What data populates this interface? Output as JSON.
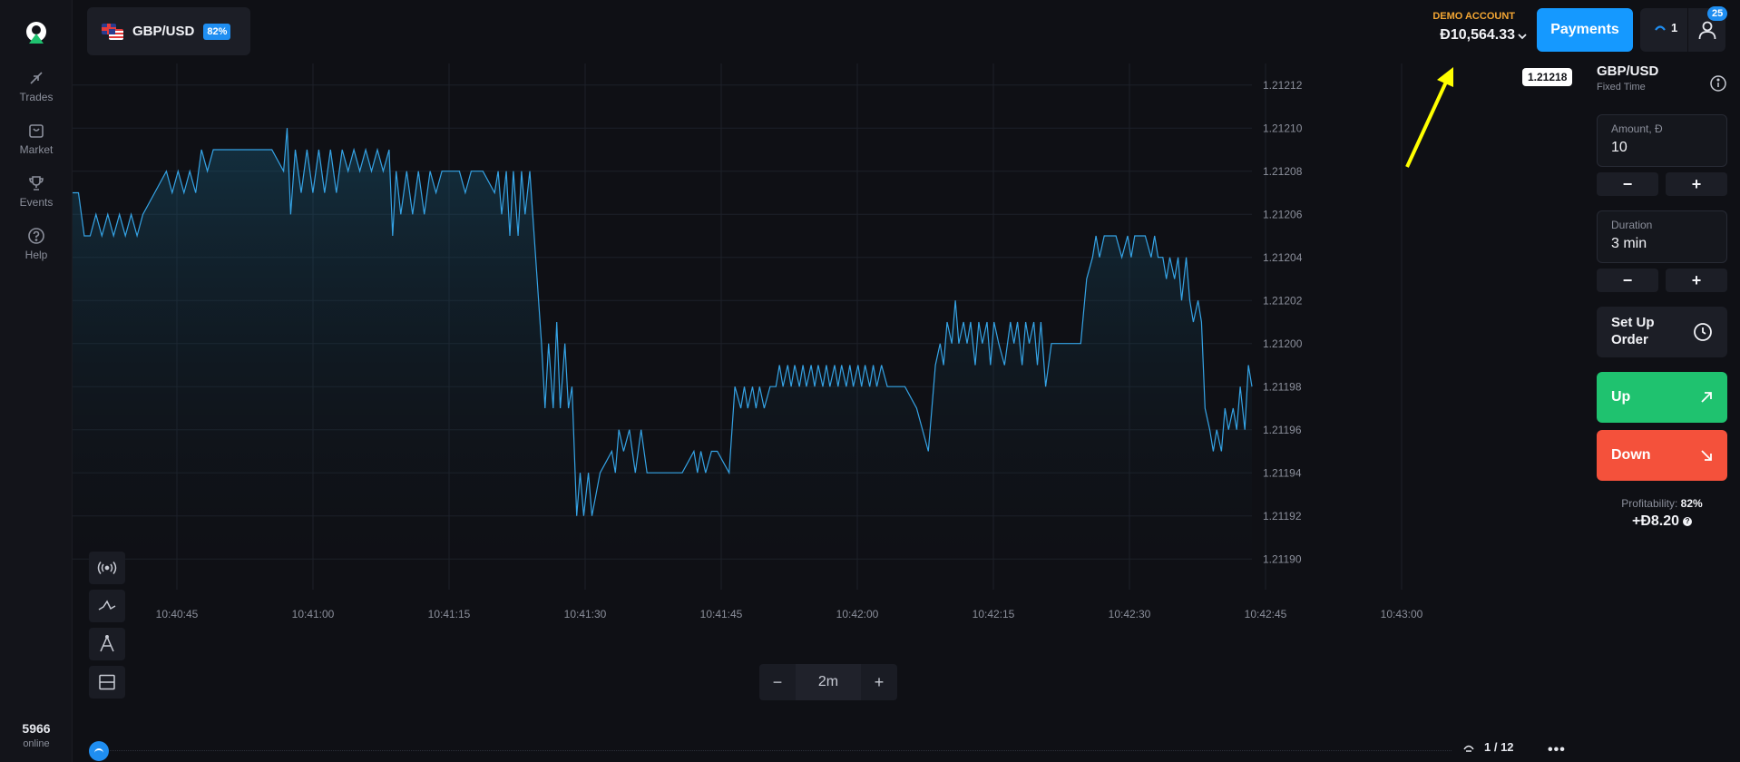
{
  "sidebar": {
    "items": [
      {
        "label": "Trades",
        "icon": "trades-icon"
      },
      {
        "label": "Market",
        "icon": "market-icon"
      },
      {
        "label": "Events",
        "icon": "trophy-icon"
      },
      {
        "label": "Help",
        "icon": "help-icon"
      }
    ],
    "online_count": "5966",
    "online_label": "online"
  },
  "header": {
    "pair": "GBP/USD",
    "payout_badge": "82%",
    "account_label": "DEMO ACCOUNT",
    "balance": "Đ10,564.33",
    "payments_label": "Payments",
    "open_trades": "1",
    "notifications": "25"
  },
  "chart_data": {
    "type": "area",
    "symbol": "GBP/USD",
    "x_tick_labels": [
      "10:40:45",
      "10:41:00",
      "10:41:15",
      "10:41:30",
      "10:41:45",
      "10:42:00",
      "10:42:15",
      "10:42:30",
      "10:42:45",
      "10:43:00"
    ],
    "y_tick_labels": [
      "1.21212",
      "1.21210",
      "1.21208",
      "1.21206",
      "1.21204",
      "1.21202",
      "1.21200",
      "1.21198",
      "1.21196",
      "1.21194",
      "1.21192",
      "1.21190"
    ],
    "ylim": [
      1.21189,
      1.21213
    ],
    "current_price": "1.21218",
    "grid": true,
    "series_color": "#35a3e5",
    "series_points": [
      [
        0,
        1.21207
      ],
      [
        0.5,
        1.21207
      ],
      [
        1,
        1.21205
      ],
      [
        1.5,
        1.21205
      ],
      [
        2,
        1.21206
      ],
      [
        2.5,
        1.21205
      ],
      [
        3,
        1.21206
      ],
      [
        3.5,
        1.21205
      ],
      [
        4,
        1.21206
      ],
      [
        4.5,
        1.21205
      ],
      [
        5,
        1.21206
      ],
      [
        5.5,
        1.21205
      ],
      [
        6,
        1.21206
      ],
      [
        7,
        1.21207
      ],
      [
        8,
        1.21208
      ],
      [
        8.5,
        1.21207
      ],
      [
        9,
        1.21208
      ],
      [
        9.5,
        1.21207
      ],
      [
        10,
        1.21208
      ],
      [
        10.5,
        1.21207
      ],
      [
        11,
        1.21209
      ],
      [
        11.5,
        1.21208
      ],
      [
        12,
        1.21209
      ],
      [
        13,
        1.21209
      ],
      [
        15,
        1.21209
      ],
      [
        17,
        1.21209
      ],
      [
        18,
        1.21208
      ],
      [
        18.3,
        1.2121
      ],
      [
        18.6,
        1.21206
      ],
      [
        19,
        1.21209
      ],
      [
        19.5,
        1.21207
      ],
      [
        20,
        1.21209
      ],
      [
        20.5,
        1.21207
      ],
      [
        21,
        1.21209
      ],
      [
        21.5,
        1.21207
      ],
      [
        22,
        1.21209
      ],
      [
        22.5,
        1.21207
      ],
      [
        23,
        1.21209
      ],
      [
        23.5,
        1.21208
      ],
      [
        24,
        1.21209
      ],
      [
        24.5,
        1.21208
      ],
      [
        25,
        1.21209
      ],
      [
        25.5,
        1.21208
      ],
      [
        26,
        1.21209
      ],
      [
        26.5,
        1.21208
      ],
      [
        27,
        1.21209
      ],
      [
        27.3,
        1.21205
      ],
      [
        27.6,
        1.21208
      ],
      [
        28,
        1.21206
      ],
      [
        28.5,
        1.21208
      ],
      [
        29,
        1.21206
      ],
      [
        29.5,
        1.21208
      ],
      [
        30,
        1.21206
      ],
      [
        30.5,
        1.21208
      ],
      [
        31,
        1.21207
      ],
      [
        31.5,
        1.21208
      ],
      [
        32,
        1.21208
      ],
      [
        33,
        1.21208
      ],
      [
        33.5,
        1.21207
      ],
      [
        34,
        1.21208
      ],
      [
        35,
        1.21208
      ],
      [
        36,
        1.21207
      ],
      [
        36.3,
        1.21208
      ],
      [
        36.6,
        1.21206
      ],
      [
        37,
        1.21208
      ],
      [
        37.3,
        1.21205
      ],
      [
        37.6,
        1.21208
      ],
      [
        38,
        1.21205
      ],
      [
        38.3,
        1.21208
      ],
      [
        38.6,
        1.21206
      ],
      [
        39,
        1.21208
      ],
      [
        40,
        1.212
      ],
      [
        40.3,
        1.21197
      ],
      [
        40.6,
        1.212
      ],
      [
        41,
        1.21197
      ],
      [
        41.3,
        1.21201
      ],
      [
        41.6,
        1.21197
      ],
      [
        42,
        1.212
      ],
      [
        42.3,
        1.21197
      ],
      [
        42.6,
        1.21198
      ],
      [
        43,
        1.21192
      ],
      [
        43.3,
        1.21194
      ],
      [
        43.6,
        1.21192
      ],
      [
        44,
        1.21194
      ],
      [
        44.3,
        1.21192
      ],
      [
        45,
        1.21194
      ],
      [
        46,
        1.21195
      ],
      [
        46.3,
        1.21194
      ],
      [
        46.6,
        1.21196
      ],
      [
        47,
        1.21195
      ],
      [
        47.5,
        1.21196
      ],
      [
        48,
        1.21194
      ],
      [
        48.5,
        1.21196
      ],
      [
        49,
        1.21194
      ],
      [
        50,
        1.21194
      ],
      [
        51,
        1.21194
      ],
      [
        52,
        1.21194
      ],
      [
        53,
        1.21195
      ],
      [
        53.3,
        1.21194
      ],
      [
        53.6,
        1.21195
      ],
      [
        54,
        1.21194
      ],
      [
        54.5,
        1.21195
      ],
      [
        55,
        1.21195
      ],
      [
        56,
        1.21194
      ],
      [
        56.5,
        1.21198
      ],
      [
        57,
        1.21197
      ],
      [
        57.3,
        1.21198
      ],
      [
        57.6,
        1.21197
      ],
      [
        58,
        1.21198
      ],
      [
        58.3,
        1.21197
      ],
      [
        58.6,
        1.21198
      ],
      [
        59,
        1.21197
      ],
      [
        59.5,
        1.21198
      ],
      [
        60,
        1.21198
      ],
      [
        60.3,
        1.21199
      ],
      [
        60.6,
        1.21198
      ],
      [
        61,
        1.21199
      ],
      [
        61.3,
        1.21198
      ],
      [
        61.6,
        1.21199
      ],
      [
        62,
        1.21198
      ],
      [
        62.3,
        1.21199
      ],
      [
        62.6,
        1.21198
      ],
      [
        63,
        1.21199
      ],
      [
        63.3,
        1.21198
      ],
      [
        63.6,
        1.21199
      ],
      [
        64,
        1.21198
      ],
      [
        64.3,
        1.21199
      ],
      [
        64.6,
        1.21198
      ],
      [
        65,
        1.21199
      ],
      [
        65.3,
        1.21198
      ],
      [
        65.6,
        1.21199
      ],
      [
        66,
        1.21198
      ],
      [
        66.3,
        1.21199
      ],
      [
        66.6,
        1.21198
      ],
      [
        67,
        1.21199
      ],
      [
        67.3,
        1.21198
      ],
      [
        67.6,
        1.21199
      ],
      [
        68,
        1.21198
      ],
      [
        68.3,
        1.21199
      ],
      [
        68.6,
        1.21198
      ],
      [
        69,
        1.21199
      ],
      [
        69.5,
        1.21198
      ],
      [
        70,
        1.21198
      ],
      [
        71,
        1.21198
      ],
      [
        72,
        1.21197
      ],
      [
        73,
        1.21195
      ],
      [
        73.3,
        1.21197
      ],
      [
        73.6,
        1.21199
      ],
      [
        74,
        1.212
      ],
      [
        74.3,
        1.21199
      ],
      [
        74.6,
        1.21201
      ],
      [
        75,
        1.212
      ],
      [
        75.3,
        1.21202
      ],
      [
        75.6,
        1.212
      ],
      [
        76,
        1.21201
      ],
      [
        76.3,
        1.212
      ],
      [
        76.6,
        1.21201
      ],
      [
        77,
        1.21199
      ],
      [
        77.3,
        1.21201
      ],
      [
        77.6,
        1.212
      ],
      [
        78,
        1.21201
      ],
      [
        78.3,
        1.21199
      ],
      [
        78.6,
        1.21201
      ],
      [
        79,
        1.212
      ],
      [
        79.5,
        1.21199
      ],
      [
        80,
        1.21201
      ],
      [
        80.3,
        1.212
      ],
      [
        80.6,
        1.21201
      ],
      [
        81,
        1.21199
      ],
      [
        81.3,
        1.21201
      ],
      [
        81.6,
        1.212
      ],
      [
        82,
        1.21201
      ],
      [
        82.3,
        1.21199
      ],
      [
        82.6,
        1.21201
      ],
      [
        83,
        1.21198
      ],
      [
        83.5,
        1.212
      ],
      [
        84,
        1.212
      ],
      [
        85,
        1.212
      ],
      [
        86,
        1.212
      ],
      [
        86.5,
        1.21203
      ],
      [
        87,
        1.21204
      ],
      [
        87.3,
        1.21205
      ],
      [
        87.6,
        1.21204
      ],
      [
        88,
        1.21205
      ],
      [
        88.5,
        1.21205
      ],
      [
        89,
        1.21205
      ],
      [
        89.5,
        1.21204
      ],
      [
        90,
        1.21205
      ],
      [
        90.3,
        1.21204
      ],
      [
        90.6,
        1.21205
      ],
      [
        91,
        1.21205
      ],
      [
        91.5,
        1.21205
      ],
      [
        92,
        1.21204
      ],
      [
        92.3,
        1.21205
      ],
      [
        92.6,
        1.21204
      ],
      [
        93,
        1.21204
      ],
      [
        93.3,
        1.21203
      ],
      [
        93.6,
        1.21204
      ],
      [
        94,
        1.21203
      ],
      [
        94.3,
        1.21204
      ],
      [
        94.6,
        1.21202
      ],
      [
        95,
        1.21204
      ],
      [
        95.3,
        1.21202
      ],
      [
        95.6,
        1.21201
      ],
      [
        96,
        1.21202
      ],
      [
        96.3,
        1.21201
      ],
      [
        96.6,
        1.21197
      ],
      [
        97,
        1.21196
      ],
      [
        97.3,
        1.21195
      ],
      [
        97.6,
        1.21196
      ],
      [
        98,
        1.21195
      ],
      [
        98.3,
        1.21197
      ],
      [
        98.6,
        1.21196
      ],
      [
        99,
        1.21197
      ],
      [
        99.3,
        1.21196
      ],
      [
        99.6,
        1.21198
      ],
      [
        100,
        1.21196
      ],
      [
        100.3,
        1.21199
      ],
      [
        100.6,
        1.21198
      ]
    ],
    "x_domain": [
      0,
      100.6
    ]
  },
  "chart_controls": {
    "zoom_minus": "−",
    "zoom_value": "2m",
    "zoom_plus": "+",
    "page": "1 / 12",
    "more": "•••"
  },
  "panel": {
    "title": "GBP/USD",
    "subtitle": "Fixed Time",
    "amount_label": "Amount, Đ",
    "amount_value": "10",
    "duration_label": "Duration",
    "duration_value": "3 min",
    "minus": "−",
    "plus": "+",
    "setup_label": "Set Up Order",
    "up_label": "Up",
    "down_label": "Down",
    "profitability_label": "Profitability:",
    "profitability_value": "82%",
    "profit_amount": "+Đ8.20",
    "help_mark": "?"
  },
  "colors": {
    "accent": "#1599ff",
    "up": "#1fc26f",
    "down": "#f4513b",
    "demo_label": "#f2a533",
    "annotation_arrow": "#ffff00"
  }
}
